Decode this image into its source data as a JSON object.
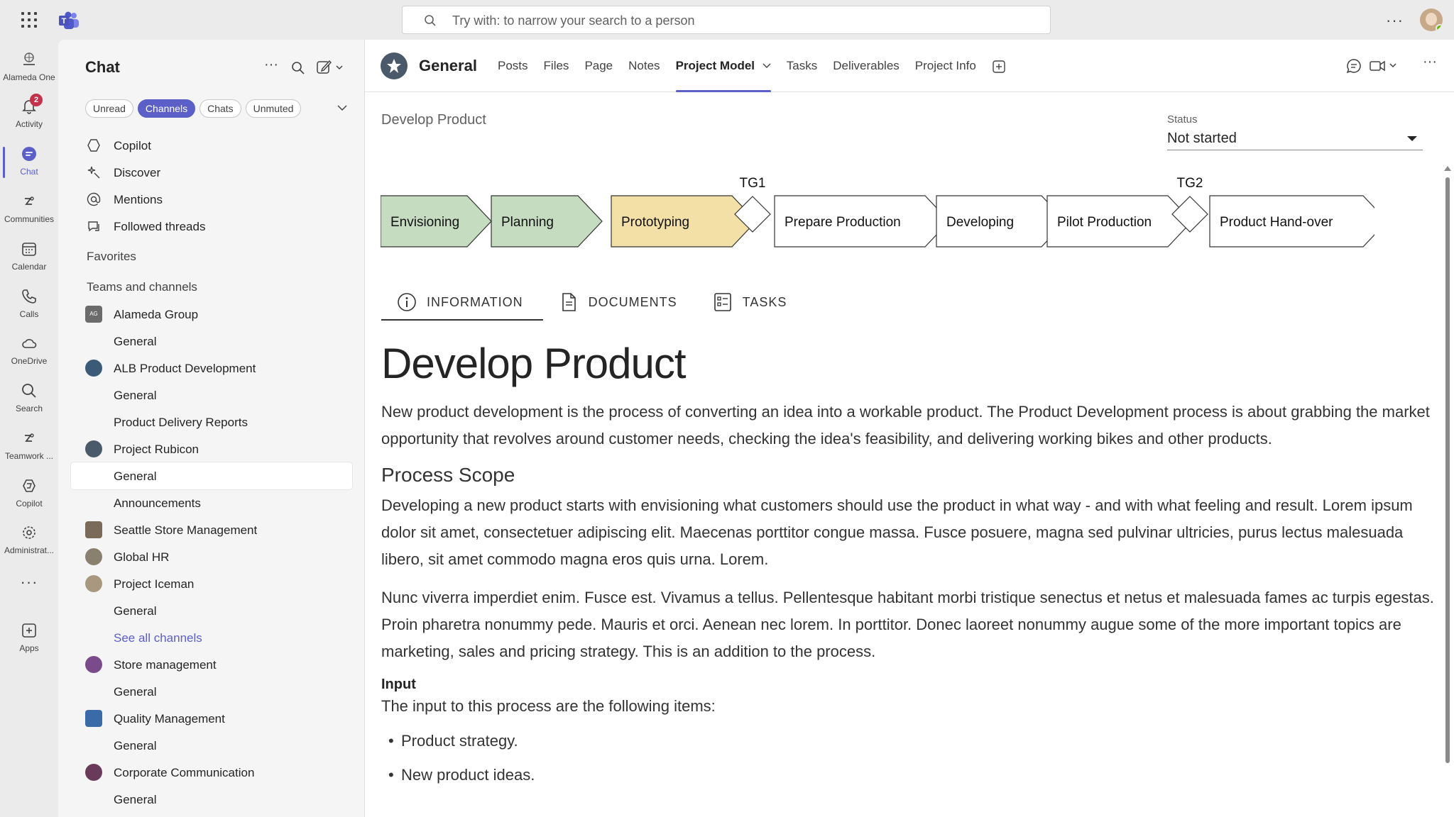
{
  "search": {
    "placeholder": "Try with: to narrow your search to a person"
  },
  "rail": {
    "items": [
      {
        "label": "Alameda One",
        "icon": "org-logo-icon"
      },
      {
        "label": "Activity",
        "icon": "bell-icon",
        "badge": "2"
      },
      {
        "label": "Chat",
        "icon": "chat-icon",
        "active": true
      },
      {
        "label": "Communities",
        "icon": "communities-icon"
      },
      {
        "label": "Calendar",
        "icon": "calendar-icon"
      },
      {
        "label": "Calls",
        "icon": "phone-icon"
      },
      {
        "label": "OneDrive",
        "icon": "cloud-icon"
      },
      {
        "label": "Search",
        "icon": "search-icon"
      },
      {
        "label": "Teamwork ...",
        "icon": "teamwork-icon"
      },
      {
        "label": "Copilot",
        "icon": "copilot-icon"
      },
      {
        "label": "Administrat...",
        "icon": "admin-icon"
      },
      {
        "label": "Apps",
        "icon": "plus-square-icon"
      }
    ]
  },
  "chat": {
    "title": "Chat",
    "filters": [
      "Unread",
      "Channels",
      "Chats",
      "Unmuted"
    ],
    "active_filter": "Channels",
    "quick": [
      {
        "label": "Copilot",
        "icon": "copilot-icon"
      },
      {
        "label": "Discover",
        "icon": "discover-icon"
      },
      {
        "label": "Mentions",
        "icon": "at-icon"
      },
      {
        "label": "Followed threads",
        "icon": "followed-threads-icon"
      }
    ],
    "favorites_label": "Favorites",
    "teams_label": "Teams and channels",
    "teams": [
      {
        "name": "Alameda Group",
        "avatar": "AG",
        "color": "#6b6b6b",
        "channels": [
          "General"
        ]
      },
      {
        "name": "ALB Product Development",
        "color": "#3a5a78",
        "channels": [
          "General",
          "Product Delivery Reports"
        ]
      },
      {
        "name": "Project Rubicon",
        "color": "#4a5a6a",
        "channels": [
          "General",
          "Announcements"
        ],
        "selected": "General"
      },
      {
        "name": "Seattle Store Management",
        "color": "#7a6a5a",
        "channels": []
      },
      {
        "name": "Global HR",
        "color": "#8a8070",
        "channels": []
      },
      {
        "name": "Project Iceman",
        "color": "#a89880",
        "channels": [
          "General"
        ],
        "see_all": "See all channels"
      },
      {
        "name": "Store management",
        "color": "#7a4a8a",
        "channels": [
          "General"
        ]
      },
      {
        "name": "Quality Management",
        "color": "#3a6aa8",
        "channels": [
          "General"
        ]
      },
      {
        "name": "Corporate Communication",
        "color": "#6a3a5a",
        "channels": [
          "General"
        ]
      }
    ]
  },
  "channel": {
    "name": "General",
    "tabs": [
      "Posts",
      "Files",
      "Page",
      "Notes",
      "Project Model",
      "Tasks",
      "Deliverables",
      "Project Info"
    ],
    "active_tab": "Project Model"
  },
  "page": {
    "breadcrumb": "Develop Product",
    "status_label": "Status",
    "status_value": "Not started",
    "process": {
      "steps": [
        {
          "label": "Envisioning",
          "color": "#c5dcc0"
        },
        {
          "label": "Planning",
          "color": "#c5dcc0"
        },
        {
          "label": "Prototyping",
          "color": "#f3e0a6"
        },
        {
          "label": "Prepare Production",
          "color": "#ffffff"
        },
        {
          "label": "Developing",
          "color": "#ffffff"
        },
        {
          "label": "Pilot Production",
          "color": "#ffffff"
        },
        {
          "label": "Product Hand-over",
          "color": "#ffffff"
        }
      ],
      "gates": [
        "TG1",
        "TG2"
      ]
    },
    "inner_tabs": [
      "INFORMATION",
      "DOCUMENTS",
      "TASKS"
    ],
    "active_inner_tab": "INFORMATION",
    "title": "Develop Product",
    "intro": "New product development is the process of converting an idea into a workable product. The Product Development process is about grabbing the market opportunity that revolves around customer needs, checking the idea's feasibility, and delivering working bikes and other products.",
    "scope_heading": "Process Scope",
    "scope_p1": "Developing a new product starts with envisioning what customers should use the product in what way - and with what feeling and result. Lorem ipsum dolor sit amet, consectetuer adipiscing elit. Maecenas porttitor congue massa. Fusce posuere, magna sed pulvinar ultricies, purus lectus malesuada libero, sit amet commodo magna eros quis urna. Lorem.",
    "scope_p2": "Nunc viverra imperdiet enim. Fusce est. Vivamus a tellus. Pellentesque habitant morbi tristique senectus et netus et malesuada fames ac turpis egestas. Proin pharetra nonummy pede. Mauris et orci. Aenean nec lorem. In porttitor. Donec laoreet nonummy augue some of the more important topics are marketing, sales and pricing strategy. This is an addition to the process.",
    "input_heading": "Input",
    "input_intro": "The input to this process are the following items:",
    "input_items": [
      "Product strategy.",
      "New product ideas."
    ]
  },
  "colors": {
    "accent": "#5b5fc7",
    "badge": "#c4314b",
    "presence": "#6bb700"
  }
}
